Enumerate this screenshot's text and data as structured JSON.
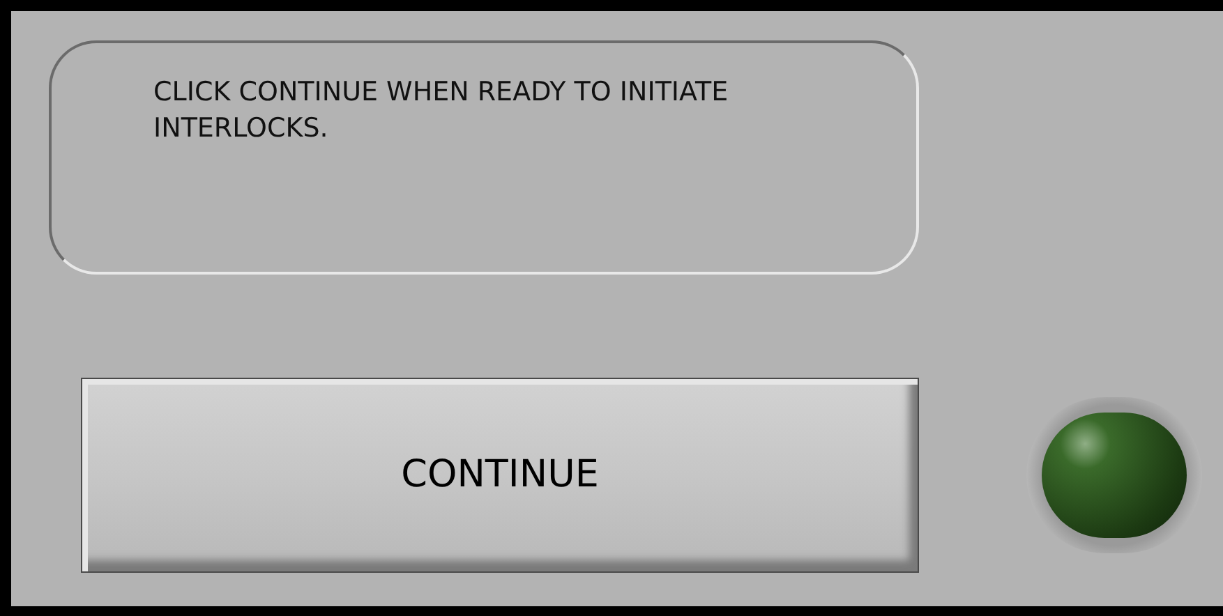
{
  "message": {
    "text": "CLICK CONTINUE WHEN READY TO INITIATE INTERLOCKS."
  },
  "continue_button": {
    "label": "CONTINUE"
  },
  "indicator": {
    "on": false
  }
}
